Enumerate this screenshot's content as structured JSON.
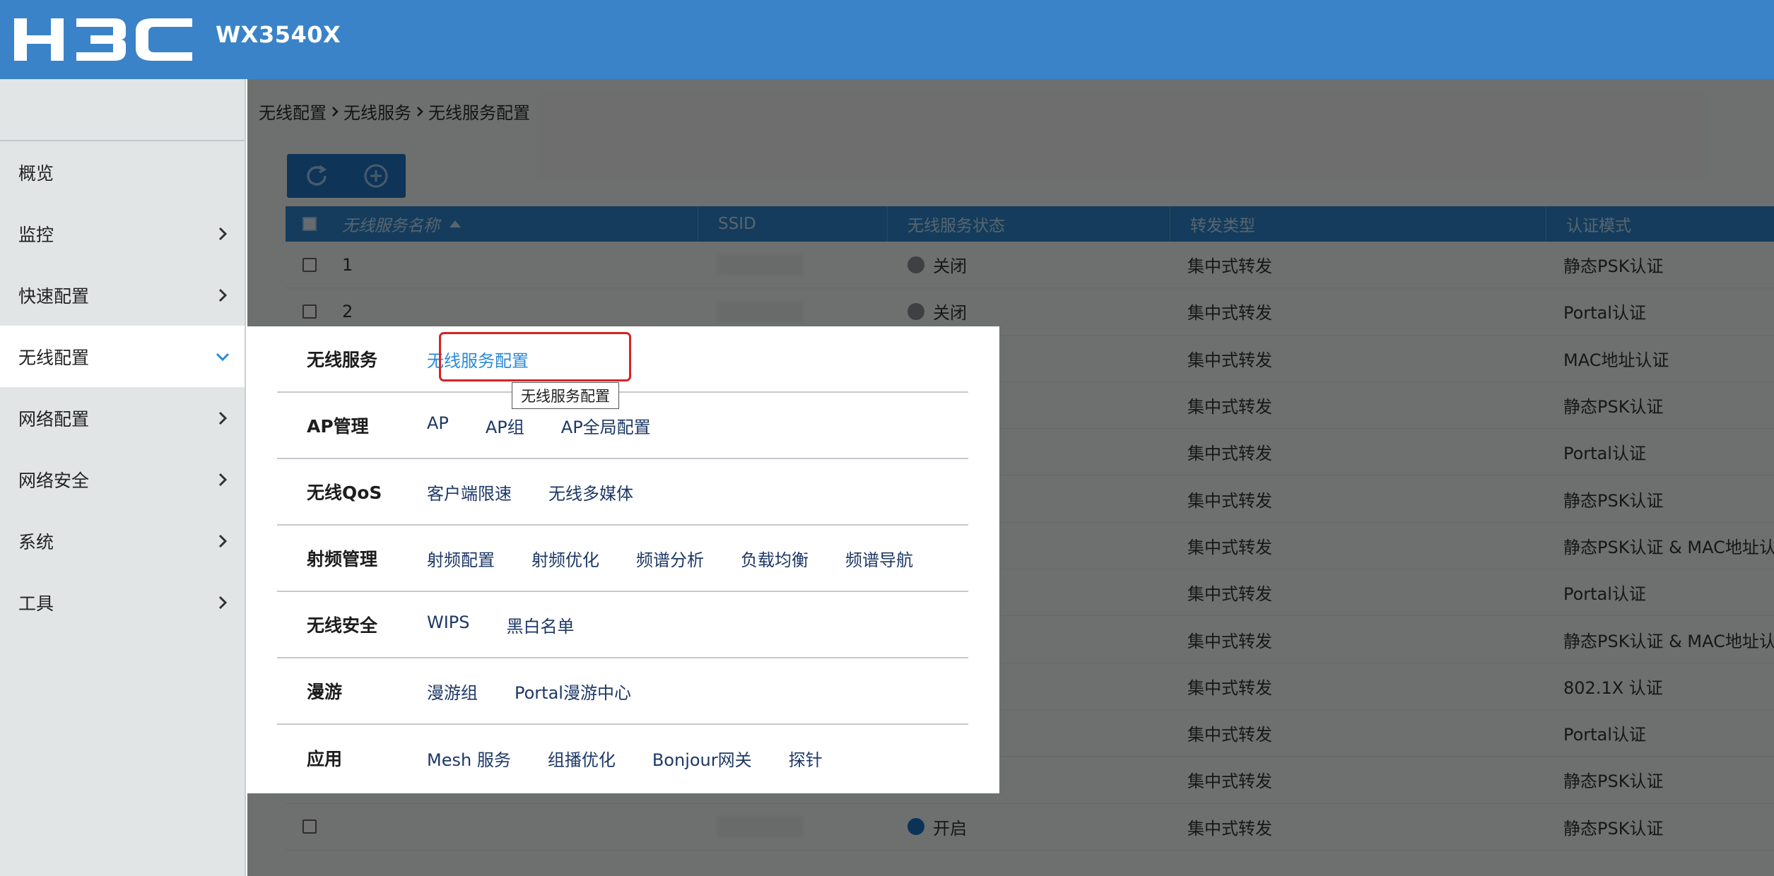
{
  "header": {
    "model": "WX3540X",
    "brand_color": "#3a83c8"
  },
  "sidebar": {
    "items": [
      {
        "label": "概览",
        "has_chevron": false
      },
      {
        "label": "监控",
        "has_chevron": true
      },
      {
        "label": "快速配置",
        "has_chevron": true
      },
      {
        "label": "无线配置",
        "has_chevron": true,
        "active": true
      },
      {
        "label": "网络配置",
        "has_chevron": true
      },
      {
        "label": "网络安全",
        "has_chevron": true
      },
      {
        "label": "系统",
        "has_chevron": true
      },
      {
        "label": "工具",
        "has_chevron": true
      }
    ]
  },
  "breadcrumb": {
    "items": [
      "无线配置",
      "无线服务",
      "无线服务配置"
    ],
    "separator": "chevron-right-icon"
  },
  "toolbar": {
    "refresh_icon": "refresh-icon",
    "add_icon": "add-circle-icon"
  },
  "table": {
    "columns": [
      "无线服务名称",
      "SSID",
      "无线服务状态",
      "转发类型",
      "认证模式"
    ],
    "sort_icon": "sort-asc-icon",
    "rows": [
      {
        "name": "1",
        "state": "关闭",
        "state_on": false,
        "forward": "集中式转发",
        "auth": "静态PSK认证"
      },
      {
        "name": "2",
        "state": "关闭",
        "state_on": false,
        "forward": "集中式转发",
        "auth": "Portal认证"
      },
      {
        "name": "",
        "state": "",
        "state_on": false,
        "forward": "集中式转发",
        "auth": "MAC地址认证"
      },
      {
        "name": "",
        "state": "",
        "state_on": false,
        "forward": "集中式转发",
        "auth": "静态PSK认证"
      },
      {
        "name": "",
        "state": "",
        "state_on": false,
        "forward": "集中式转发",
        "auth": "Portal认证"
      },
      {
        "name": "",
        "state": "",
        "state_on": false,
        "forward": "集中式转发",
        "auth": "静态PSK认证"
      },
      {
        "name": "",
        "state": "",
        "state_on": false,
        "forward": "集中式转发",
        "auth": "静态PSK认证 & MAC地址认证"
      },
      {
        "name": "",
        "state": "",
        "state_on": false,
        "forward": "集中式转发",
        "auth": "Portal认证"
      },
      {
        "name": "",
        "state": "",
        "state_on": false,
        "forward": "集中式转发",
        "auth": "静态PSK认证 & MAC地址认证"
      },
      {
        "name": "",
        "state": "",
        "state_on": false,
        "forward": "集中式转发",
        "auth": "802.1X 认证"
      },
      {
        "name": "",
        "state": "",
        "state_on": false,
        "forward": "集中式转发",
        "auth": "Portal认证"
      },
      {
        "name": "",
        "state": "",
        "state_on": false,
        "forward": "集中式转发",
        "auth": "静态PSK认证"
      },
      {
        "name": "",
        "state": "开启",
        "state_on": true,
        "forward": "集中式转发",
        "auth": "静态PSK认证"
      }
    ]
  },
  "menu": {
    "groups": [
      {
        "title": "无线服务",
        "items": [
          "无线服务配置"
        ]
      },
      {
        "title": "AP管理",
        "items": [
          "AP",
          "AP组",
          "AP全局配置"
        ]
      },
      {
        "title": "无线QoS",
        "items": [
          "客户端限速",
          "无线多媒体"
        ]
      },
      {
        "title": "射频管理",
        "items": [
          "射频配置",
          "射频优化",
          "频谱分析",
          "负载均衡",
          "频谱导航"
        ]
      },
      {
        "title": "无线安全",
        "items": [
          "WIPS",
          "黑白名单"
        ]
      },
      {
        "title": "漫游",
        "items": [
          "漫游组",
          "Portal漫游中心"
        ]
      },
      {
        "title": "应用",
        "items": [
          "Mesh 服务",
          "组播优化",
          "Bonjour网关",
          "探针"
        ]
      }
    ],
    "tooltip": "无线服务配置",
    "highlight_color": "#d62323",
    "current_link_color": "#2b8ad8"
  }
}
